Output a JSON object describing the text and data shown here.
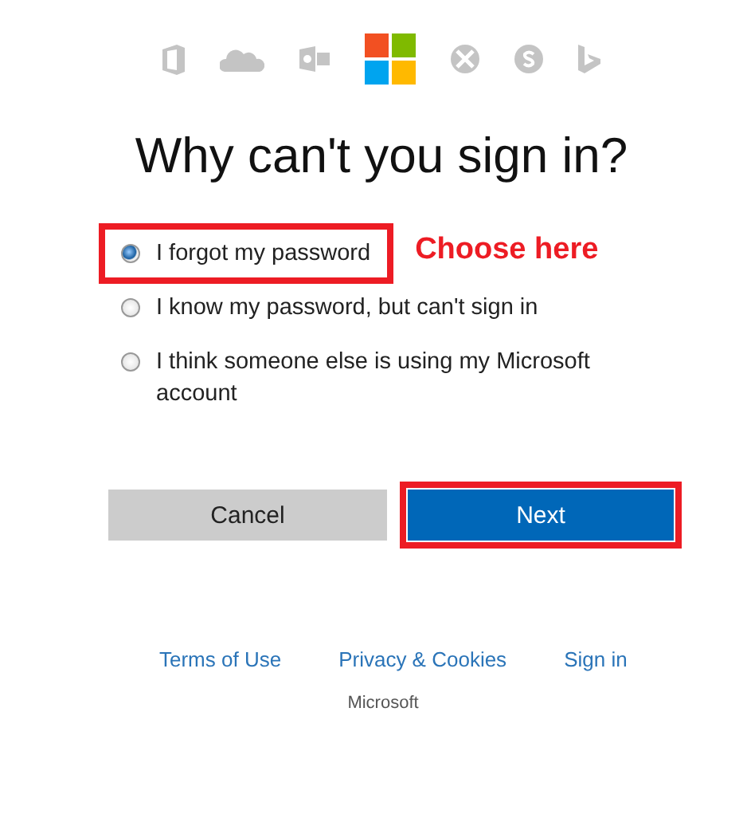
{
  "title": "Why can't you sign in?",
  "options": [
    {
      "label": "I forgot my password",
      "selected": true,
      "highlighted": true
    },
    {
      "label": "I know my password, but can't sign in",
      "selected": false,
      "highlighted": false
    },
    {
      "label": "I think someone else is using my Microsoft account",
      "selected": false,
      "highlighted": false
    }
  ],
  "callout": "Choose here",
  "buttons": [
    {
      "label": "Cancel",
      "kind": "secondary",
      "highlighted": false
    },
    {
      "label": "Next",
      "kind": "primary",
      "highlighted": true
    }
  ],
  "footer_links": [
    "Terms of Use",
    "Privacy & Cookies",
    "Sign in"
  ],
  "brand": "Microsoft"
}
